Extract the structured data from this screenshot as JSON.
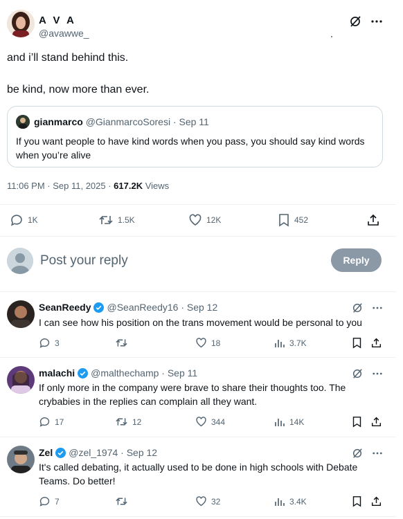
{
  "tweet": {
    "display_name": "A V A",
    "handle": "@avawwe_",
    "lines": [
      "and i’ll stand behind this.",
      "be kind, now more than ever."
    ],
    "quote": {
      "name": "gianmarco",
      "handle_date": "@GianmarcoSoresi · Sep 11",
      "text": "If you want people to have kind words when you pass, you should say kind words when you’re alive"
    },
    "time": "11:06 PM · Sep 11, 2025 · ",
    "views_count": "617.2K",
    "views_label": " Views",
    "actions": {
      "replies": "1K",
      "reposts": "1.5K",
      "likes": "12K",
      "bookmarks": "452"
    }
  },
  "reply_box": {
    "placeholder": "Post your reply",
    "button": "Reply"
  },
  "replies": [
    {
      "name": "SeanReedy",
      "meta": "@SeanReedy16 · Sep 12",
      "text": "I can see how his position on the trans movement would be personal to you",
      "replies": "3",
      "reposts": "",
      "likes": "18",
      "views": "3.7K"
    },
    {
      "name": "malachi",
      "meta": "@malthechamp · Sep 11",
      "text": "If only more in the company were brave to share their thoughts too. The crybabies in the replies can complain all they want.",
      "replies": "17",
      "reposts": "12",
      "likes": "344",
      "views": "14K"
    },
    {
      "name": "Zel",
      "meta": "@zel_1974 · Sep 12",
      "text": "It's called debating, it actually used to be done in high schools with Debate Teams. Do better!",
      "replies": "7",
      "reposts": "",
      "likes": "32",
      "views": "3.4K"
    }
  ],
  "colors": {
    "verified": "#1d9bf0",
    "muted": "#536471",
    "reply_button": "#8b98a5"
  }
}
